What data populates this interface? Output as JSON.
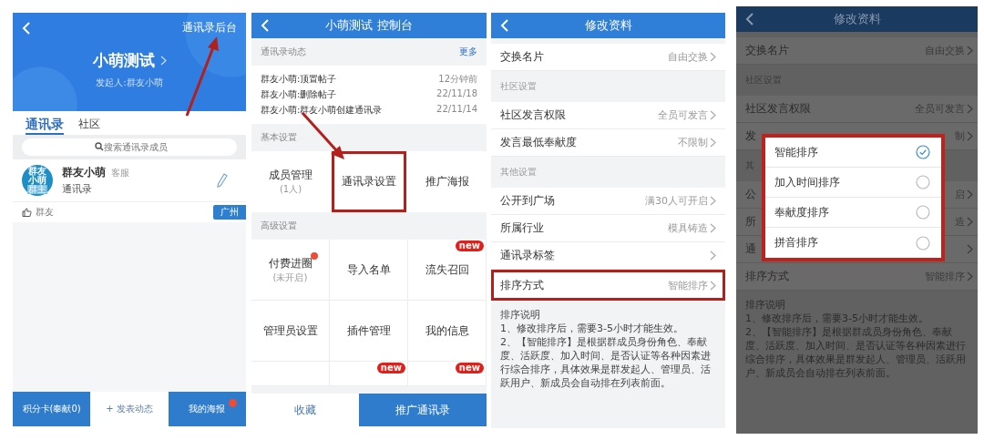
{
  "home": {
    "header_link": "通讯录后台",
    "title": "小萌测试",
    "subtitle": "发起人:群友小萌",
    "tabs": [
      {
        "label": "通讯录",
        "selected": true
      },
      {
        "label": "社区",
        "selected": false
      }
    ],
    "search": {
      "placeholder": "搜索通讯录成员"
    },
    "member": {
      "avatar_lines": [
        "群友",
        "小萌"
      ],
      "avatar_badge": "群主",
      "name": "群友小萌",
      "role": "客服",
      "subtitle": "通讯录",
      "like_label": "群友",
      "tag": "广州"
    },
    "bottom_bar": [
      {
        "label": "积分卡(奉献0)",
        "kind": "filled",
        "dot": false
      },
      {
        "label": "+ 发表动态",
        "kind": "plain",
        "dot": false
      },
      {
        "label": "我的海报",
        "kind": "filled",
        "dot": true
      }
    ]
  },
  "console": {
    "title": "小萌测试 控制台",
    "feed_section": {
      "title": "通讯录动态",
      "more": "更多"
    },
    "feed": [
      {
        "text": "群友小萌:顶置帖子",
        "time": "12分钟前"
      },
      {
        "text": "群友小萌:删除帖子",
        "time": "22/11/18"
      },
      {
        "text": "群友小萌:群友小萌创建通讯录",
        "time": "22/11/14"
      }
    ],
    "basic_section": "基本设置",
    "basic_items": [
      {
        "label": "成员管理",
        "sub": "(1人)",
        "highlighted": false
      },
      {
        "label": "通讯录设置",
        "highlighted": true
      },
      {
        "label": "推广海报",
        "highlighted": false
      }
    ],
    "advanced_section": "高级设置",
    "advanced_items": [
      {
        "label": "付费进圈",
        "sub": "(未开启)",
        "dot": true
      },
      {
        "label": "导入名单",
        "dot": false
      },
      {
        "label": "流失召回",
        "dot": false,
        "badge": "new"
      },
      {
        "label": "管理员设置",
        "dot": false
      },
      {
        "label": "插件管理",
        "dot": false
      },
      {
        "label": "我的信息",
        "dot": false
      },
      {
        "dot": false
      },
      {
        "dot": false,
        "badge": "new"
      },
      {
        "dot": false,
        "badge": "new"
      }
    ],
    "bottom": {
      "collect": "收藏",
      "promote": "推广通讯录"
    }
  },
  "edit_profile": {
    "title": "修改资料",
    "rows": [
      {
        "kind": "setting",
        "label": "交换名片",
        "value": "自由交换",
        "highlighted": false
      },
      {
        "kind": "section",
        "label": "社区设置"
      },
      {
        "kind": "setting",
        "label": "社区发言权限",
        "value": "全员可发言",
        "highlighted": false
      },
      {
        "kind": "setting",
        "label": "发言最低奉献度",
        "value": "不限制",
        "highlighted": false
      },
      {
        "kind": "section",
        "label": "其他设置"
      },
      {
        "kind": "setting",
        "label": "公开到广场",
        "value": "满30人可开启",
        "highlighted": false
      },
      {
        "kind": "setting",
        "label": "所属行业",
        "value": "模具铸造",
        "highlighted": false
      },
      {
        "kind": "setting",
        "label": "通讯录标签",
        "highlighted": false
      },
      {
        "kind": "setting",
        "label": "排序方式",
        "value": "智能排序",
        "highlighted": true
      }
    ],
    "note": {
      "title": "排序说明",
      "lines": [
        "1、修改排序后，需要3-5小时才能生效。",
        "2、【智能排序】是根据群成员身份角色、奉献度、活跃度、加入时间、是否认证等各种因素进行综合排序，具体效果是群发起人、管理员、活跃用户、新成员会自动排在列表前面。"
      ]
    }
  },
  "sort_screen": {
    "title": "修改资料",
    "rows": [
      {
        "kind": "setting",
        "label": "交换名片",
        "value": "自由交换"
      },
      {
        "kind": "section",
        "label": "社区设置"
      },
      {
        "kind": "setting",
        "label": "社区发言权限",
        "value": "全员可发言"
      },
      {
        "kind": "setting",
        "label": "发",
        "value": "制"
      },
      {
        "kind": "section",
        "label": "其"
      },
      {
        "kind": "setting",
        "label": "公",
        "value": "启"
      },
      {
        "kind": "setting",
        "label": "所",
        "value": "造"
      },
      {
        "kind": "setting",
        "label": "通"
      },
      {
        "kind": "setting",
        "label": "排序方式",
        "value": "智能排序"
      }
    ],
    "note": {
      "title": "排序说明",
      "lines": [
        "1、修改排序后，需要3-5小时才能生效。",
        "2、【智能排序】是根据群成员身份角色、奉献度、活跃度、加入时间、是否认证等各种因素进行综合排序，具体效果是群发起人、管理员、活跃用户、新成员会自动排在列表前面。"
      ]
    },
    "dialog": {
      "options": [
        {
          "label": "智能排序",
          "selected": true
        },
        {
          "label": "加入时间排序",
          "selected": false
        },
        {
          "label": "奉献度排序",
          "selected": false
        },
        {
          "label": "拼音排序",
          "selected": false
        }
      ]
    }
  }
}
